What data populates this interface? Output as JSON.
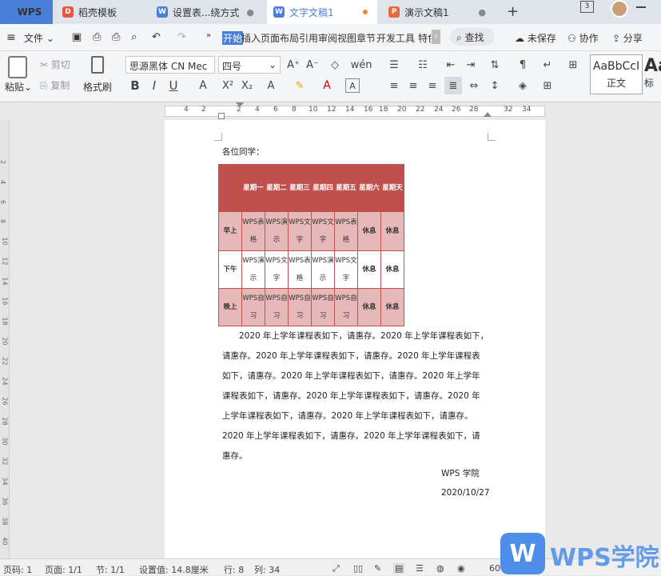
{
  "tabs": {
    "wps": "WPS",
    "t1": "稻壳模板",
    "t2": "设置表...绕方式",
    "t3": "文字文稿1",
    "t4": "演示文稿1",
    "add": "+",
    "badge": "3"
  },
  "menu": {
    "file": "文件",
    "items": [
      "开始",
      "插入",
      "页面布局",
      "引用",
      "审阅",
      "视图",
      "章节",
      "开发工具",
      "特色"
    ],
    "search": "查找",
    "unsaved": "未保存",
    "collab": "协作",
    "share": "分享"
  },
  "ribbon": {
    "paste": "粘贴",
    "cut": "剪切",
    "copy": "复制",
    "format_painter": "格式刷",
    "font_name": "思源黑体 CN Mec",
    "font_size": "四号",
    "style_normal": "正文",
    "style_sample": "AaBbCcI",
    "style_sample2": "Aa",
    "style_heading": "标"
  },
  "ruler": [
    "4",
    "2",
    "2",
    "4",
    "6",
    "8",
    "10",
    "12",
    "14",
    "16",
    "18",
    "20",
    "22",
    "24",
    "26",
    "28",
    "32",
    "34"
  ],
  "vruler": [
    "2",
    "4",
    "6",
    "8",
    "10",
    "12",
    "14",
    "16",
    "18",
    "20",
    "22",
    "24",
    "26",
    "28",
    "30",
    "32",
    "34",
    "36",
    "38",
    "40"
  ],
  "document": {
    "greeting": "各位同学：",
    "table": {
      "header": [
        "",
        "星期一",
        "星期二",
        "星期三",
        "星期四",
        "星期五",
        "星期六",
        "星期天"
      ],
      "rows": [
        {
          "label": "早上",
          "cells": [
            "WPS表格",
            "WPS演示",
            "WPS文字",
            "WPS文字",
            "WPS表格",
            "休息",
            "休息"
          ]
        },
        {
          "label": "下午",
          "cells": [
            "WPS演示",
            "WPS文字",
            "WPS表格",
            "WPS演示",
            "WPS文字",
            "休息",
            "休息"
          ]
        },
        {
          "label": "晚上",
          "cells": [
            "WPS自习",
            "WPS自习",
            "WPS自习",
            "WPS自习",
            "WPS自习",
            "休息",
            "休息"
          ]
        }
      ]
    },
    "lines": [
      "　　2020 年上学年课程表如下，请惠存。2020 年上学年课程表如下，",
      "请惠存。2020 年上学年课程表如下，请惠存。2020 年上学年课程表",
      "如下，请惠存。2020 年上学年课程表如下，请惠存。2020 年上学年",
      "课程表如下，请惠存。2020 年上学年课程表如下，请惠存。2020 年",
      "上学年课程表如下，请惠存。2020 年上学年课程表如下，请惠存。",
      "2020 年上学年课程表如下，请惠存。2020 年上学年课程表如下，请",
      "惠存。"
    ],
    "signature": "WPS 学院",
    "date": "2020/10/27"
  },
  "status": {
    "page_code": "页码: 1",
    "page": "页面: 1/1",
    "section": "节: 1/1",
    "setting": "设置值: 14.8厘米",
    "row": "行: 8",
    "col": "列: 34",
    "zoom": "60%"
  },
  "watermark": "WPS学院",
  "colors": {
    "accent": "#4a7fd9",
    "table_header": "#c0504d",
    "table_band": "#e6b8b7"
  }
}
